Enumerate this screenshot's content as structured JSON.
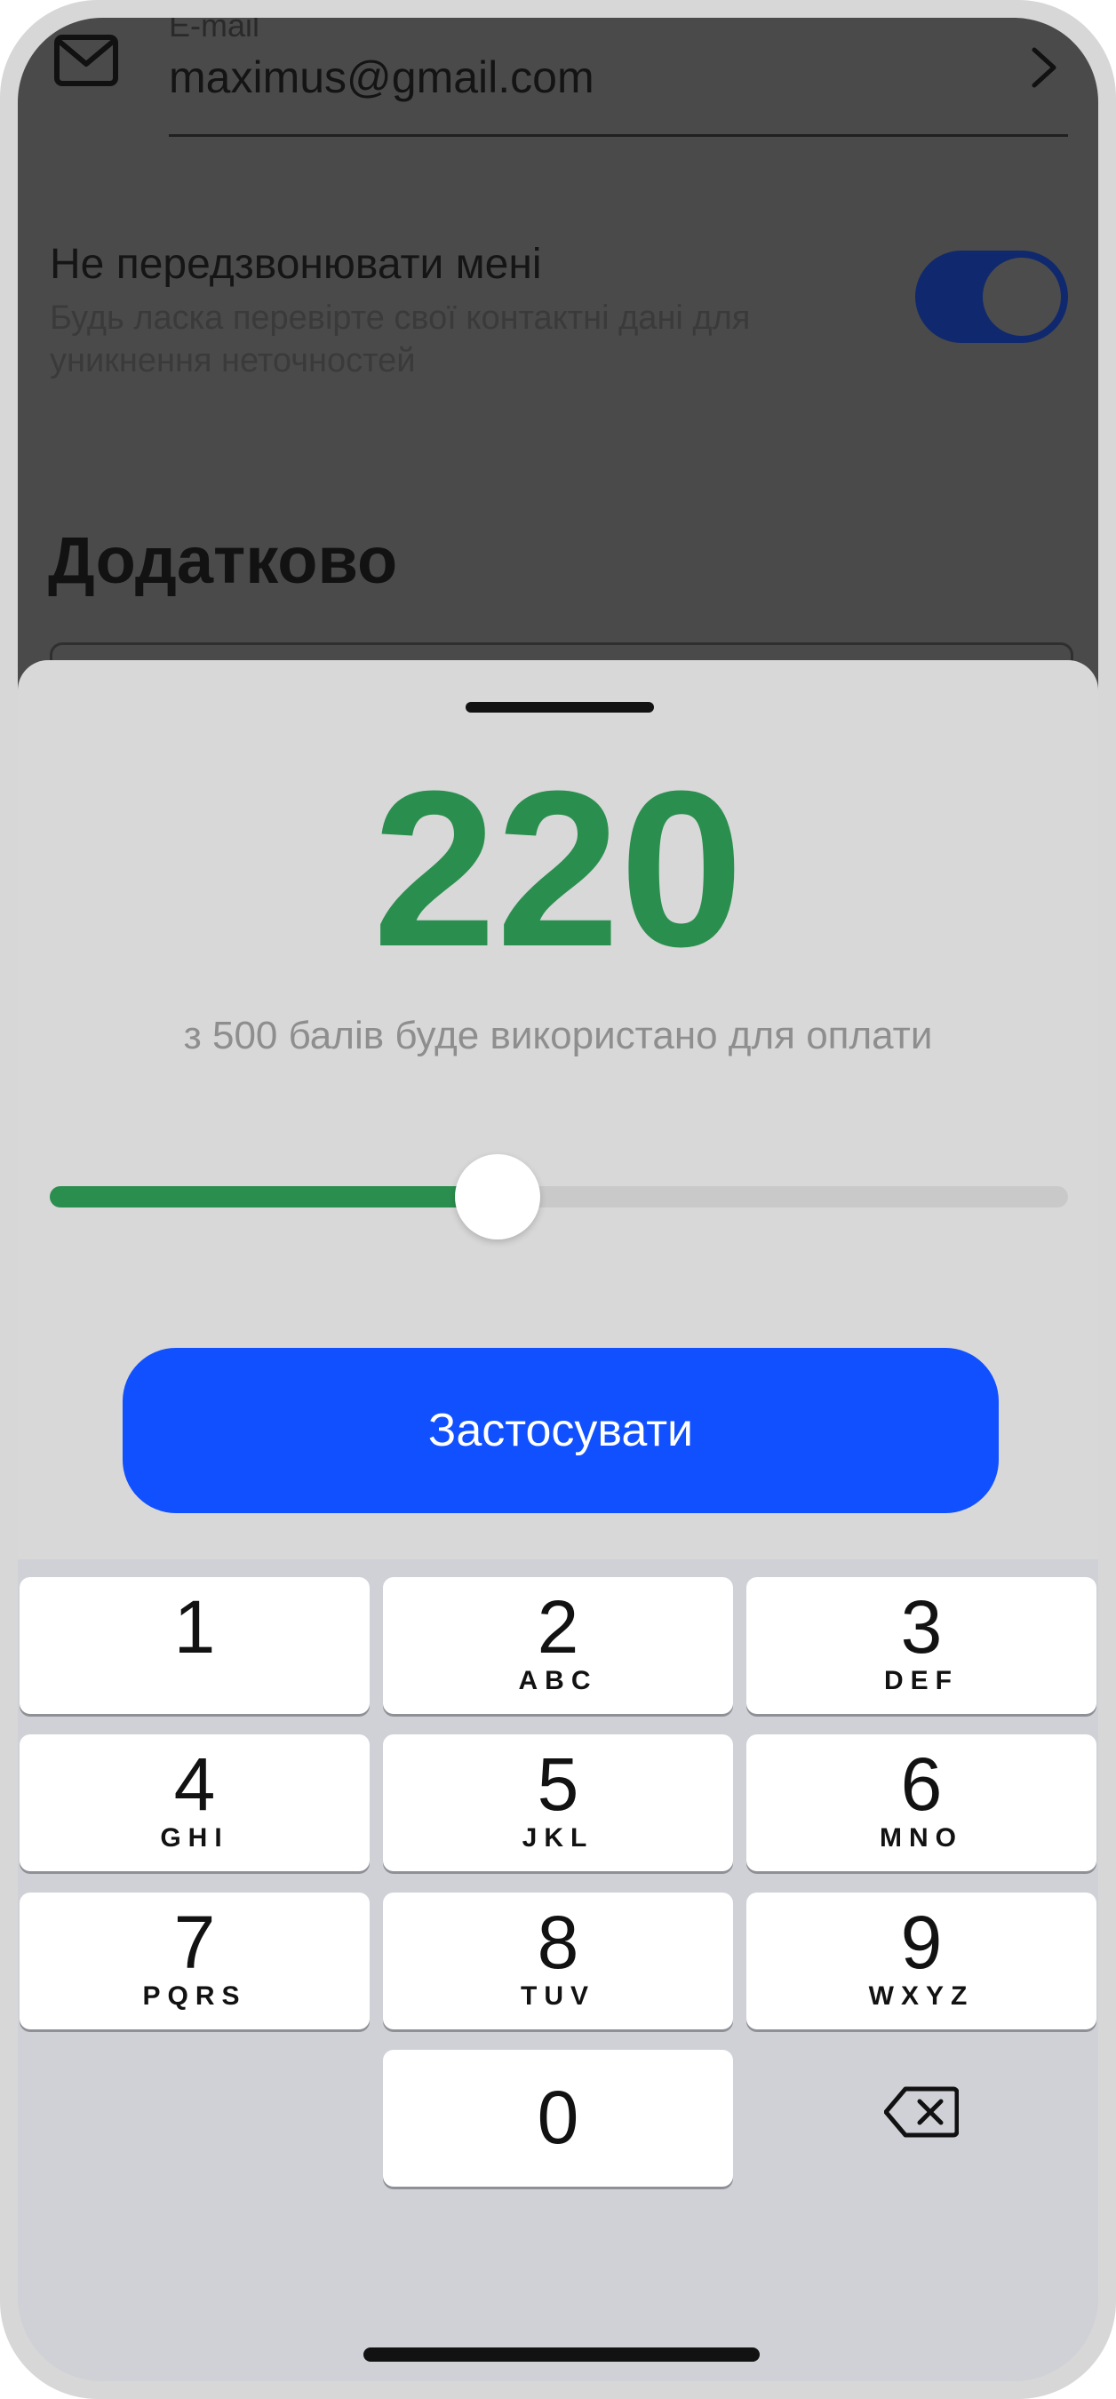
{
  "background": {
    "email_label": "E-mail",
    "email_value": "maximus@gmail.com",
    "dnc_title": "Не передзвонювати мені",
    "dnc_description": "Будь ласка перевірте свої контактні дані для уникнення неточностей",
    "dnc_toggle_on": true,
    "section_title": "Додатково"
  },
  "sheet": {
    "points_value": "220",
    "points_caption": "з 500 балів буде використано для оплати",
    "slider_value": 220,
    "slider_max": 500,
    "apply_label": "Застосувати"
  },
  "keypad": {
    "keys": [
      {
        "digit": "1",
        "letters": ""
      },
      {
        "digit": "2",
        "letters": "ABC"
      },
      {
        "digit": "3",
        "letters": "DEF"
      },
      {
        "digit": "4",
        "letters": "GHI"
      },
      {
        "digit": "5",
        "letters": "JKL"
      },
      {
        "digit": "6",
        "letters": "MNO"
      },
      {
        "digit": "7",
        "letters": "PQRS"
      },
      {
        "digit": "8",
        "letters": "TUV"
      },
      {
        "digit": "9",
        "letters": "WXYZ"
      },
      {
        "digit": "0",
        "letters": ""
      }
    ],
    "backspace_icon": "backspace-icon"
  },
  "colors": {
    "accent_green": "#2a8f4e",
    "button_blue": "#1150ff",
    "toggle_blue": "#10296e"
  }
}
